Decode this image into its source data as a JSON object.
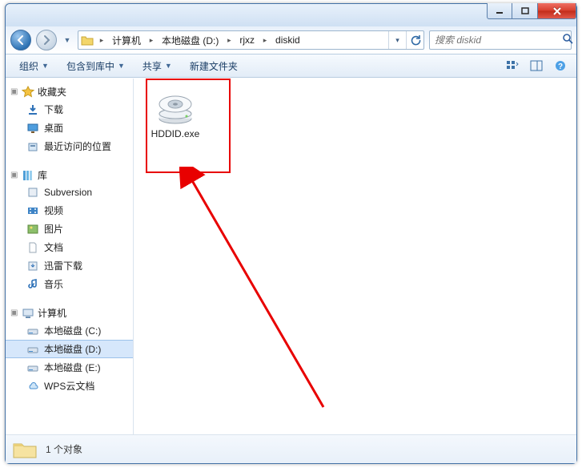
{
  "window": {
    "title": ""
  },
  "nav_buttons": {
    "back_enabled": true,
    "forward_enabled": false
  },
  "breadcrumbs": [
    {
      "label": "计算机"
    },
    {
      "label": "本地磁盘 (D:)"
    },
    {
      "label": "rjxz"
    },
    {
      "label": "diskid"
    }
  ],
  "search": {
    "placeholder": "搜索 diskid"
  },
  "toolbar": {
    "organize": "组织",
    "include": "包含到库中",
    "share": "共享",
    "newfolder": "新建文件夹"
  },
  "sidebar": {
    "favorites": {
      "label": "收藏夹",
      "items": [
        {
          "label": "下载"
        },
        {
          "label": "桌面"
        },
        {
          "label": "最近访问的位置"
        }
      ]
    },
    "libraries": {
      "label": "库",
      "items": [
        {
          "label": "Subversion"
        },
        {
          "label": "视频"
        },
        {
          "label": "图片"
        },
        {
          "label": "文档"
        },
        {
          "label": "迅雷下载"
        },
        {
          "label": "音乐"
        }
      ]
    },
    "computer": {
      "label": "计算机",
      "items": [
        {
          "label": "本地磁盘 (C:)"
        },
        {
          "label": "本地磁盘 (D:)"
        },
        {
          "label": "本地磁盘 (E:)"
        },
        {
          "label": "WPS云文档"
        }
      ],
      "selected_index": 1
    }
  },
  "files": [
    {
      "name": "HDDID.exe"
    }
  ],
  "statusbar": {
    "count_text": "1 个对象"
  }
}
